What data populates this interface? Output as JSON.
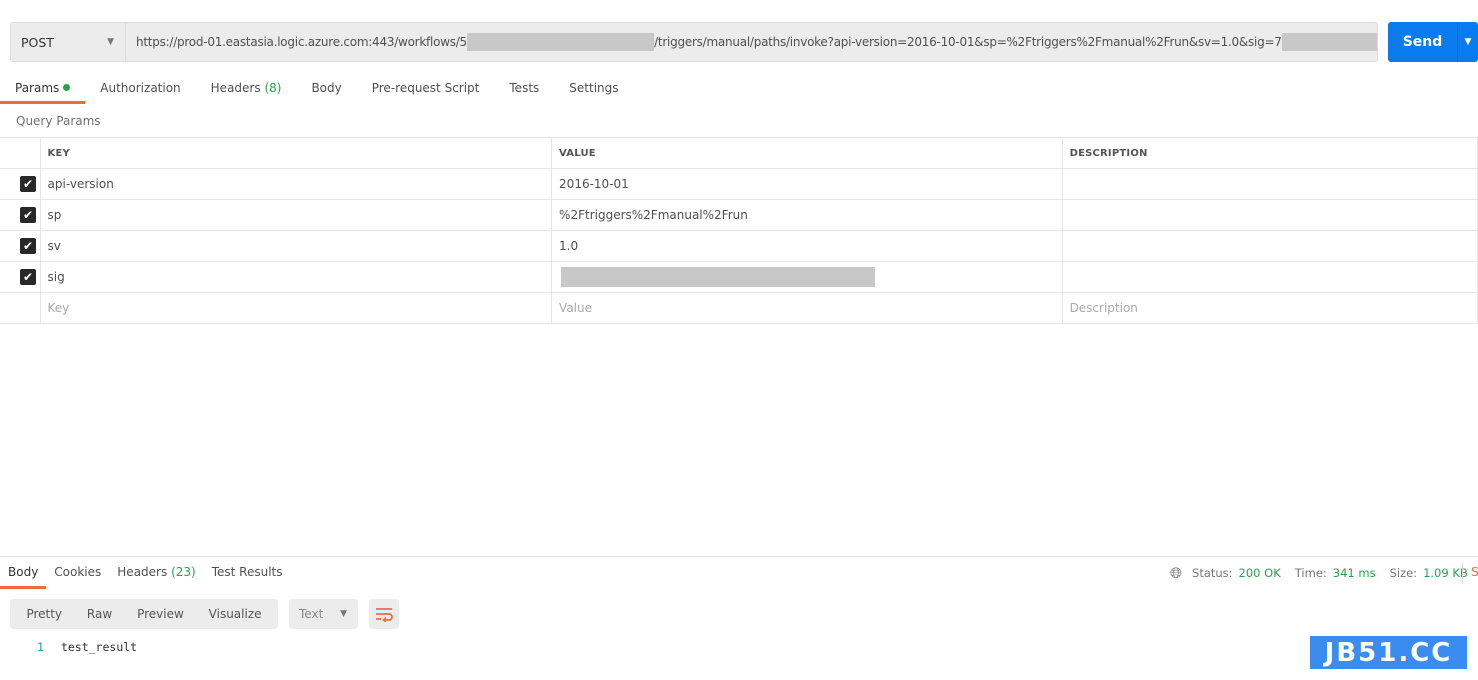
{
  "request": {
    "method": "POST",
    "url_prefix": "https://prod-01.eastasia.logic.azure.com:443/workflows/5",
    "url_middle": "/triggers/manual/paths/invoke?api-version=2016-10-01&sp=%2Ftriggers%2Fmanual%2Frun&sv=1.0&sig=7",
    "send_label": "Send"
  },
  "request_tabs": [
    {
      "label": "Params"
    },
    {
      "label": "Authorization"
    },
    {
      "label": "Headers",
      "count": "(8)"
    },
    {
      "label": "Body"
    },
    {
      "label": "Pre-request Script"
    },
    {
      "label": "Tests"
    },
    {
      "label": "Settings"
    }
  ],
  "query_params": {
    "title": "Query Params",
    "columns": [
      "KEY",
      "VALUE",
      "DESCRIPTION"
    ],
    "rows": [
      {
        "key": "api-version",
        "value": "2016-10-01",
        "checked": true
      },
      {
        "key": "sp",
        "value": "%2Ftriggers%2Fmanual%2Frun",
        "checked": true
      },
      {
        "key": "sv",
        "value": "1.0",
        "checked": true
      },
      {
        "key": "sig",
        "value": "",
        "checked": true
      }
    ],
    "placeholders": {
      "key": "Key",
      "value": "Value",
      "description": "Description"
    }
  },
  "response": {
    "tabs": [
      {
        "label": "Body"
      },
      {
        "label": "Cookies"
      },
      {
        "label": "Headers",
        "count": "(23)"
      },
      {
        "label": "Test Results"
      }
    ],
    "status_label": "Status:",
    "status": "200 OK",
    "time_label": "Time:",
    "time": "341 ms",
    "size_label": "Size:",
    "size": "1.09 KB",
    "save_label": "Save Response",
    "view_modes": [
      "Pretty",
      "Raw",
      "Preview",
      "Visualize"
    ],
    "format": "Text",
    "body_lines": [
      {
        "n": "1",
        "text": "test_result"
      }
    ]
  },
  "watermark": "JB51.CC",
  "colors": {
    "accent": "#f26b3a",
    "send": "#097bed",
    "success": "#26a34a"
  }
}
